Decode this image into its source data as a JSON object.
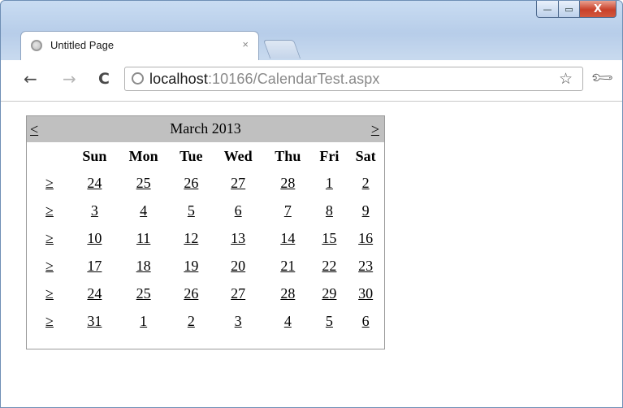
{
  "browser": {
    "tab_title": "Untitled Page",
    "tab_close": "×",
    "url_host": "localhost",
    "url_rest": ":10166/CalendarTest.aspx",
    "caption": {
      "minimize": "—",
      "maximize": "▭",
      "close": "X"
    }
  },
  "calendar": {
    "prev": "<",
    "next": ">",
    "title": "March 2013",
    "weekdays": [
      "Sun",
      "Mon",
      "Tue",
      "Wed",
      "Thu",
      "Fri",
      "Sat"
    ],
    "week_selector": "≥",
    "weeks": [
      [
        "24",
        "25",
        "26",
        "27",
        "28",
        "1",
        "2"
      ],
      [
        "3",
        "4",
        "5",
        "6",
        "7",
        "8",
        "9"
      ],
      [
        "10",
        "11",
        "12",
        "13",
        "14",
        "15",
        "16"
      ],
      [
        "17",
        "18",
        "19",
        "20",
        "21",
        "22",
        "23"
      ],
      [
        "24",
        "25",
        "26",
        "27",
        "28",
        "29",
        "30"
      ],
      [
        "31",
        "1",
        "2",
        "3",
        "4",
        "5",
        "6"
      ]
    ]
  }
}
